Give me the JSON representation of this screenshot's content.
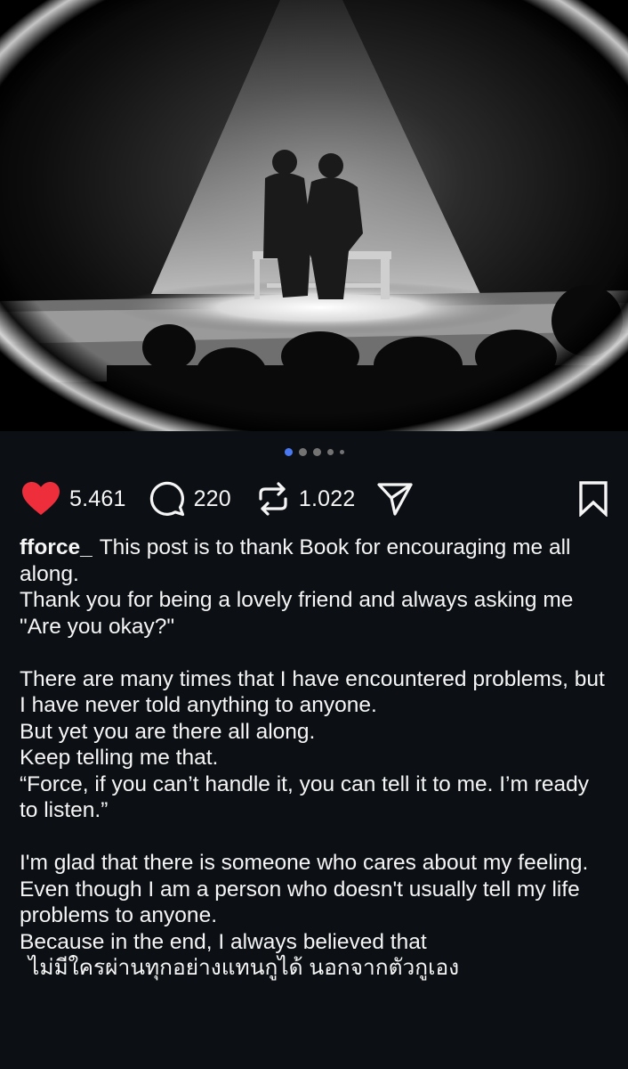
{
  "photo": {
    "icon": "stage-photo",
    "alt": ""
  },
  "carousel": {
    "total": 5,
    "active_index": 0
  },
  "actions": {
    "likes": "5.461",
    "comments": "220",
    "reposts": "1.022",
    "like_color": "#ee2e3b",
    "icons": [
      "heart-icon",
      "comment-icon",
      "repost-icon",
      "send-icon",
      "bookmark-icon"
    ]
  },
  "post": {
    "username": "fforce_",
    "lines": [
      "This post is to thank Book for encouraging me all along.",
      "Thank you for being a lovely friend and always asking me \"Are you okay?\"",
      "",
      "There are many times that I have encountered problems, but I have never told anything to anyone.",
      "But yet you are there all along.",
      "Keep telling me that.",
      "“Force, if you can’t handle it, you can tell it to me. I’m ready to listen.”",
      "",
      "I'm glad that there is someone who cares about my feeling.",
      "Even though I am a person who doesn't usually tell my life problems to anyone.",
      "Because in the end, I always believed that",
      "ไม่มีใครผ่านทุกอย่างแทนกูได้ นอกจากตัวกูเอง"
    ]
  },
  "colors": {
    "background": "#0c1014",
    "text": "#f5f5f5",
    "dot_active": "#4a78f0",
    "dot_inactive": "#737373"
  }
}
